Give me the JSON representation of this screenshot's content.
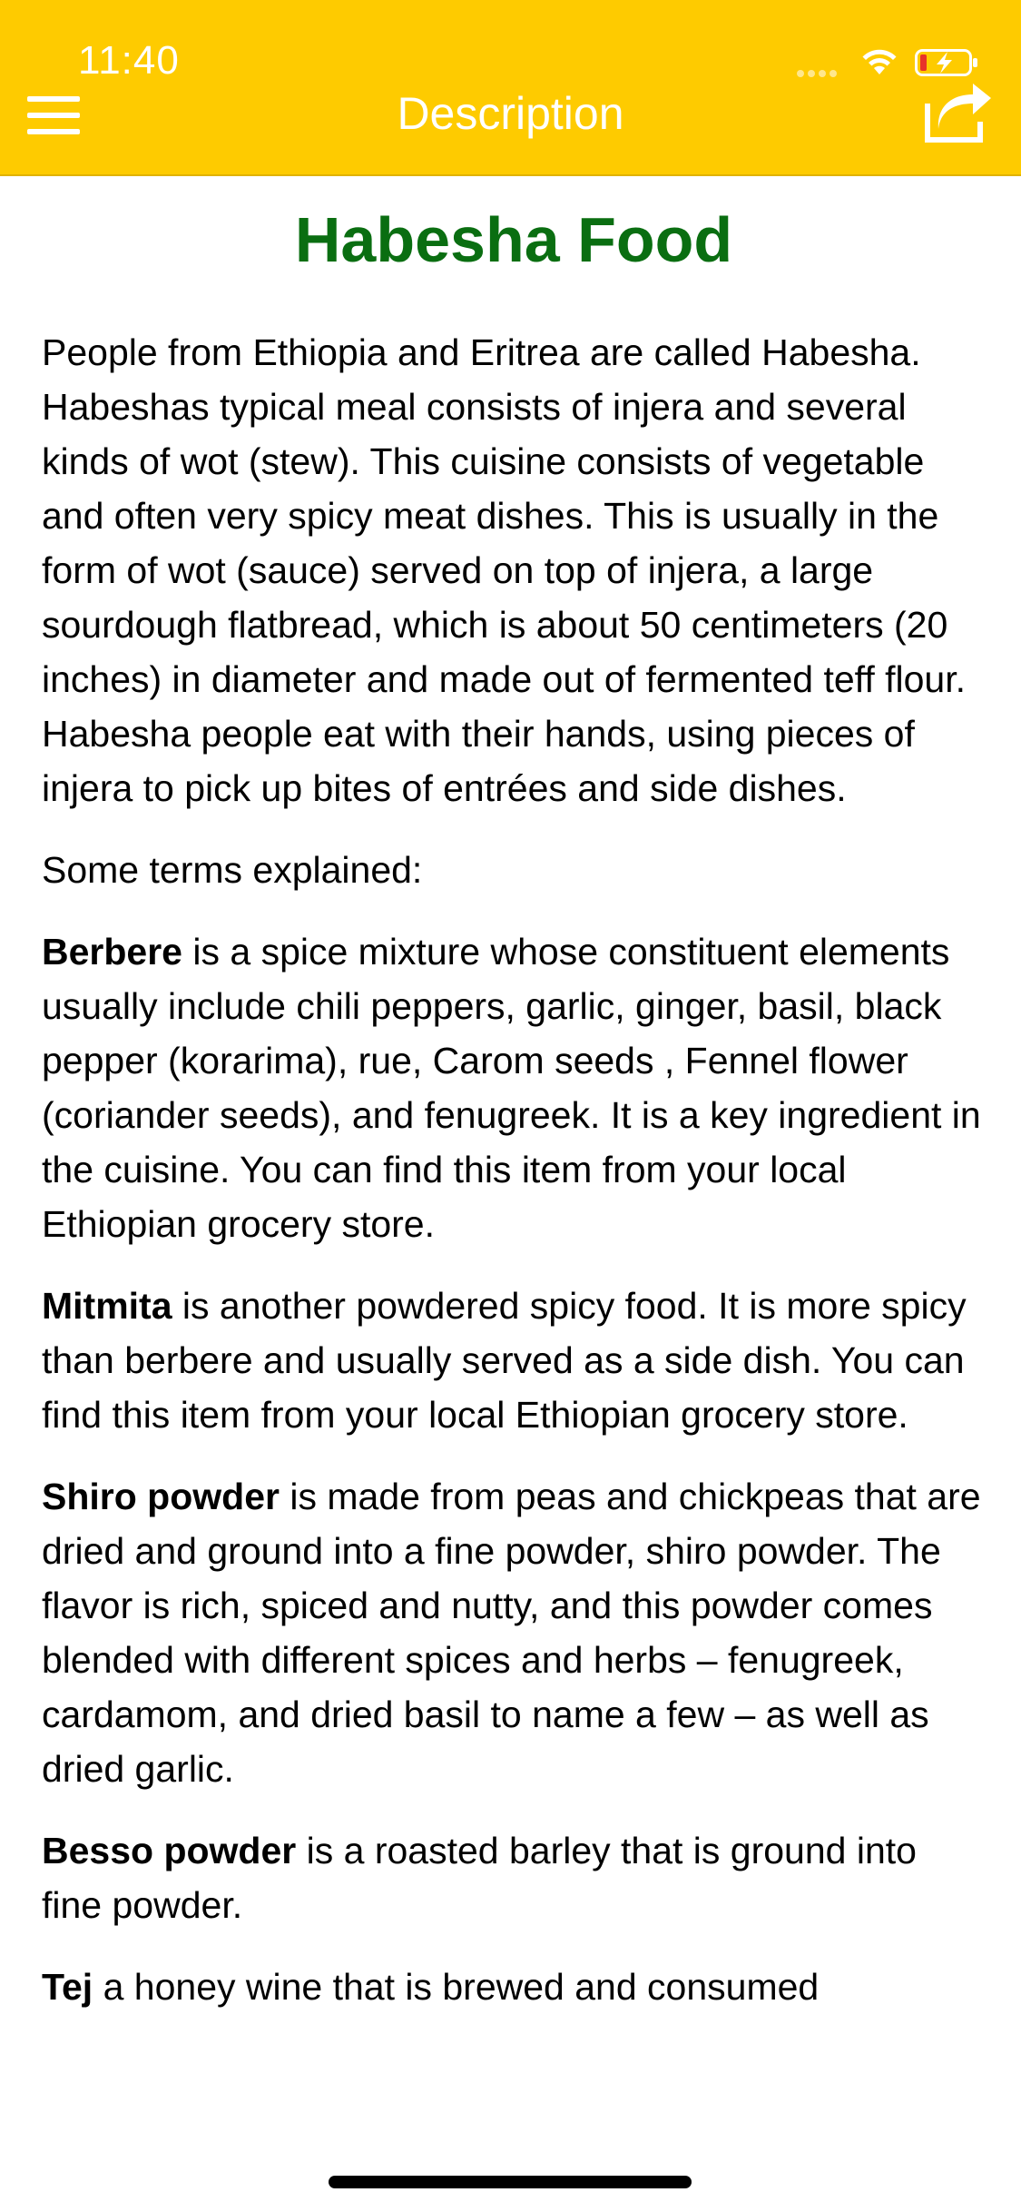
{
  "status_bar": {
    "time": "11:40"
  },
  "nav": {
    "title": "Description",
    "menu_icon": "hamburger-menu-icon",
    "share_icon": "share-icon",
    "background_color": "#FECB00"
  },
  "article": {
    "title": "Habesha Food",
    "title_color": "#0A6E11",
    "intro": "People from Ethiopia and Eritrea are called Habesha. Habeshas typical meal consists of injera and several kinds of wot (stew). This cuisine consists of vegetable and often very spicy meat dishes. This is usually in the form of wot (sauce) served on top of injera, a large sourdough flatbread, which is about 50 centimeters (20 inches) in diameter and made out of fermented teff flour. Habesha people eat with their hands, using pieces of injera to pick up bites of entrées and side dishes.",
    "terms_heading": "Some terms explained:",
    "terms": [
      {
        "term": "Berbere",
        "text": " is a spice mixture whose constituent elements usually include chili peppers, garlic, ginger, basil, black pepper (korarima), rue, Carom seeds , Fennel flower (coriander seeds), and fenugreek. It is a key ingredient in the cuisine. You can find this item from your local Ethiopian grocery store."
      },
      {
        "term": "Mitmita",
        "text": " is another powdered spicy food. It is more spicy than berbere and usually served as a side dish. You can find this item from your local Ethiopian grocery store."
      },
      {
        "term": "Shiro powder",
        "text": " is made from peas and chickpeas that are dried and ground into a fine powder, shiro powder. The flavor is rich, spiced and nutty, and this powder comes blended with different spices and herbs – fenugreek, cardamom, and dried basil to name a few – as well as dried garlic."
      },
      {
        "term": "Besso powder",
        "text": " is a roasted barley that is ground into fine powder."
      },
      {
        "term": "Tej",
        "text": " a honey wine that is brewed and consumed"
      }
    ]
  }
}
